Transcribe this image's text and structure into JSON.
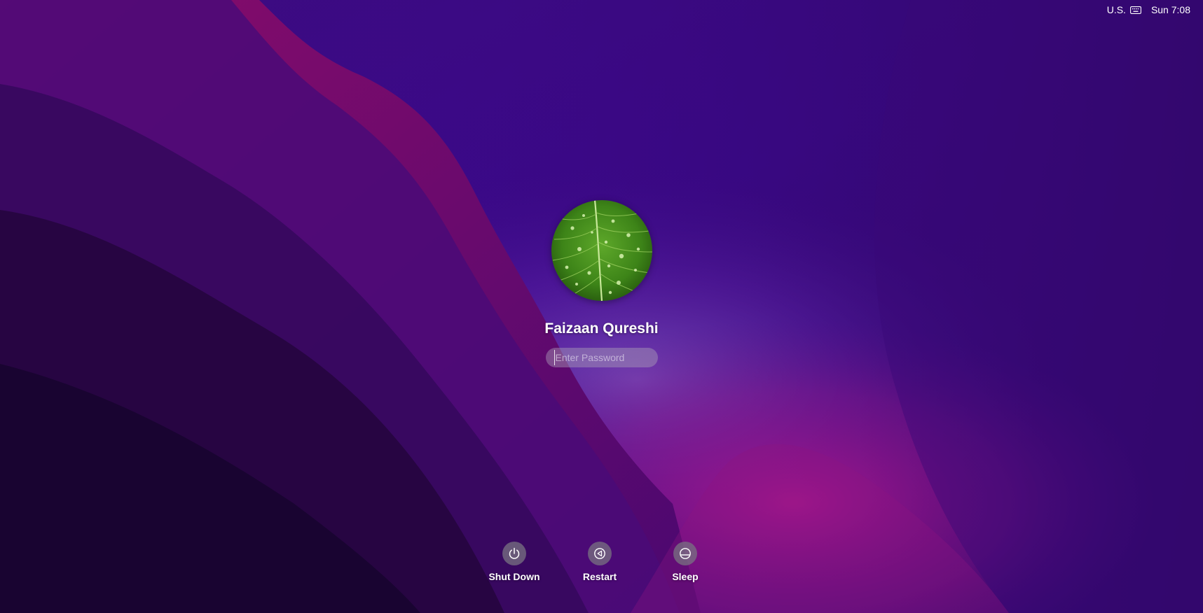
{
  "menubar": {
    "input_source": "U.S.",
    "keyboard_icon": "keyboard-icon",
    "clock": "Sun 7:08"
  },
  "user": {
    "name": "Faizaan Qureshi",
    "avatar_icon": "leaf-avatar"
  },
  "password": {
    "placeholder": "Enter Password",
    "value": ""
  },
  "actions": [
    {
      "label": "Shut Down",
      "icon": "power-icon"
    },
    {
      "label": "Restart",
      "icon": "restart-icon"
    },
    {
      "label": "Sleep",
      "icon": "sleep-icon"
    }
  ],
  "colors": {
    "wallpaper_dark": "#1a0838",
    "wallpaper_purple": "#4a0fa0",
    "wallpaper_magenta": "#a01890",
    "avatar_green": "#3f8a1a"
  }
}
